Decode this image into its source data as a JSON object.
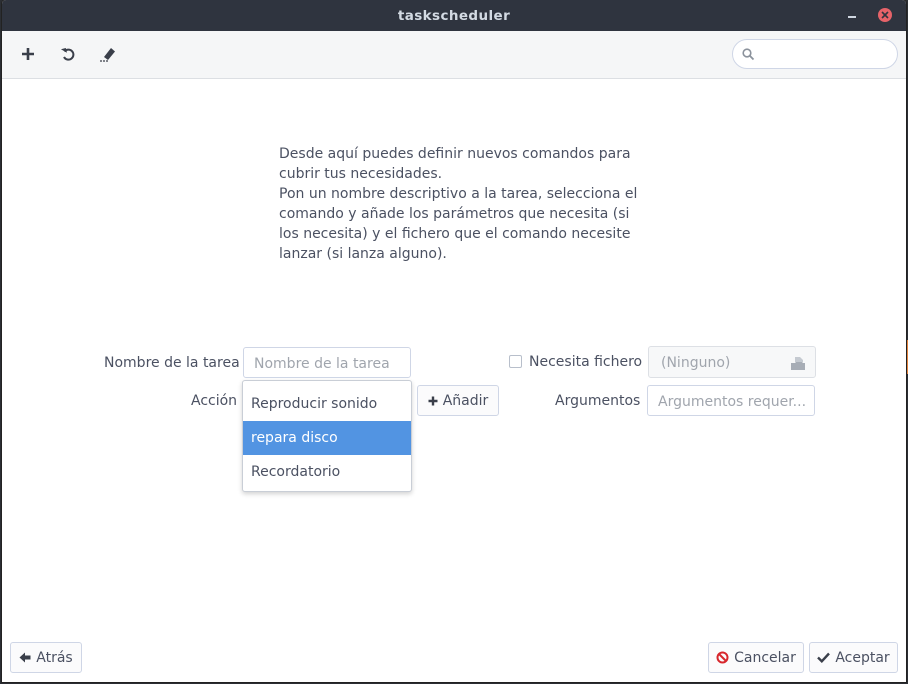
{
  "window": {
    "title": "taskscheduler"
  },
  "toolbar": {
    "buttons": [
      {
        "icon": "plus-icon"
      },
      {
        "icon": "undo-icon"
      },
      {
        "icon": "edit-clear-icon"
      }
    ],
    "search": {
      "value": "",
      "placeholder": ""
    }
  },
  "description": {
    "line1": "Desde aquí puedes definir nuevos comandos para cubrir tus necesidades.",
    "line2": "Pon un nombre descriptivo a la tarea, selecciona el comando y añade los parámetros que necesita (si los necesita) y el fichero que el comando necesite lanzar (si lanza alguno)."
  },
  "form": {
    "task_name_label": "Nombre de la tarea",
    "task_name_placeholder": "Nombre de la tarea",
    "task_name_value": "",
    "action_label": "Acción",
    "add_button": "Añadir",
    "needs_file_label": "Necesita fichero",
    "needs_file_checked": false,
    "file_value": "(Ninguno)",
    "arguments_label": "Argumentos",
    "arguments_placeholder": "Argumentos requer...",
    "arguments_value": ""
  },
  "action_menu": {
    "items": [
      {
        "label": "Reproducir sonido",
        "selected": false
      },
      {
        "label": "repara disco",
        "selected": true
      },
      {
        "label": "Recordatorio",
        "selected": false
      }
    ]
  },
  "footer": {
    "back_button": "Atrás",
    "cancel_button": "Cancelar",
    "accept_button": "Aceptar"
  },
  "colors": {
    "accent": "#5294e2",
    "titlebar": "#2f343f",
    "close": "#e66369",
    "cancel_icon": "#d7262c"
  }
}
